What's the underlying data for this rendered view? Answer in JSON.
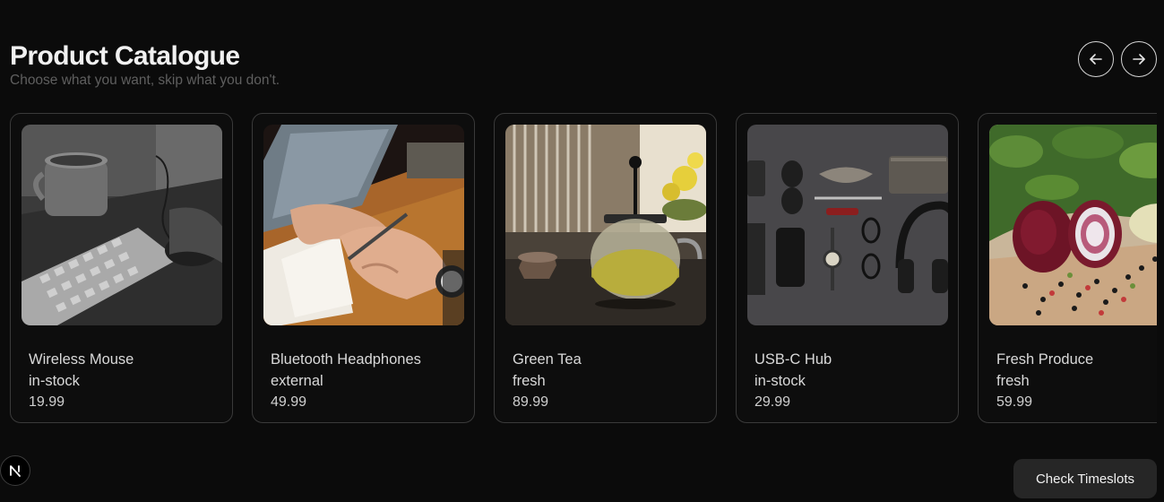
{
  "header": {
    "title": "Product Catalogue",
    "subtitle": "Choose what you want, skip what you don't."
  },
  "nav": {
    "prev_icon": "arrow-left-icon",
    "next_icon": "arrow-right-icon"
  },
  "products": [
    {
      "name": "Wireless Mouse",
      "tag": "in-stock",
      "price": "19.99",
      "image": "desk-keyboard-mug-photo"
    },
    {
      "name": "Bluetooth Headphones",
      "tag": "external",
      "price": "49.99",
      "image": "hand-writing-notebook-photo"
    },
    {
      "name": "Green Tea",
      "tag": "fresh",
      "price": "89.99",
      "image": "tea-press-pot-photo"
    },
    {
      "name": "USB-C Hub",
      "tag": "in-stock",
      "price": "29.99",
      "image": "flatlay-accessories-photo"
    },
    {
      "name": "Fresh Produce",
      "tag": "fresh",
      "price": "59.99",
      "image": "red-onion-peppercorns-photo"
    }
  ],
  "footer": {
    "badge_icon": "n-logo-icon",
    "timeslots_label": "Check Timeslots"
  }
}
